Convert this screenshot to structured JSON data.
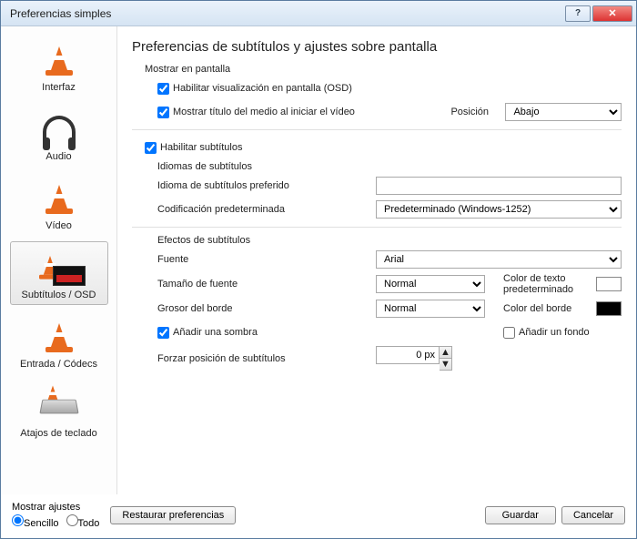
{
  "window": {
    "title": "Preferencias simples"
  },
  "sidebar": {
    "items": [
      {
        "label": "Interfaz"
      },
      {
        "label": "Audio"
      },
      {
        "label": "Vídeo"
      },
      {
        "label": "Subtítulos / OSD"
      },
      {
        "label": "Entrada / Códecs"
      },
      {
        "label": "Atajos de teclado"
      }
    ],
    "selected_index": 3
  },
  "heading": "Preferencias de subtítulos y ajustes sobre pantalla",
  "osd": {
    "group_title": "Mostrar en pantalla",
    "enable_osd": "Habilitar visualización en pantalla (OSD)",
    "enable_osd_checked": true,
    "show_title": "Mostrar título del medio al iniciar el vídeo",
    "show_title_checked": true,
    "position_label": "Posición",
    "position_value": "Abajo"
  },
  "subs": {
    "enable": "Habilitar subtítulos",
    "enable_checked": true,
    "lang_group": "Idiomas de subtítulos",
    "pref_lang_label": "Idioma de subtítulos preferido",
    "pref_lang_value": "",
    "encoding_label": "Codificación predeterminada",
    "encoding_value": "Predeterminado (Windows-1252)"
  },
  "fx": {
    "group_title": "Efectos de subtítulos",
    "font_label": "Fuente",
    "font_value": "Arial",
    "size_label": "Tamaño de fuente",
    "size_value": "Normal",
    "textcolor_label": "Color de texto predeterminado",
    "outline_label": "Grosor del borde",
    "outline_value": "Normal",
    "bordercolor_label": "Color del borde",
    "shadow_label": "Añadir una sombra",
    "shadow_checked": true,
    "background_label": "Añadir un fondo",
    "background_checked": false,
    "force_label": "Forzar posición de subtítulos",
    "force_value": "0 px"
  },
  "footer": {
    "show_settings_label": "Mostrar ajustes",
    "simple": "Sencillo",
    "all": "Todo",
    "reset": "Restaurar preferencias",
    "save": "Guardar",
    "cancel": "Cancelar"
  }
}
